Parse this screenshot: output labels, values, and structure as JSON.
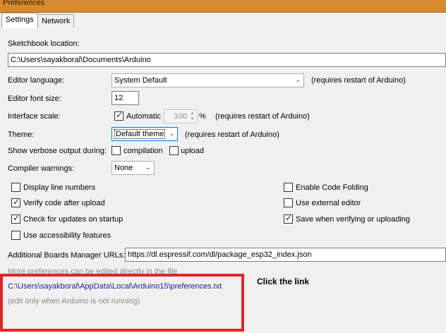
{
  "window": {
    "title": "Preferences"
  },
  "tabs": [
    {
      "label": "Settings",
      "active": true
    },
    {
      "label": "Network",
      "active": false
    }
  ],
  "settings": {
    "sketchbook_label": "Sketchbook location:",
    "sketchbook_value": "C:\\Users\\sayakboral\\Documents\\Arduino",
    "editor_language_label": "Editor language:",
    "editor_language_value": "System Default",
    "editor_language_note": "(requires restart of Arduino)",
    "font_size_label": "Editor font size:",
    "font_size_value": "12",
    "interface_scale_label": "Interface scale:",
    "automatic_label": "Automatic",
    "automatic_checked": true,
    "scale_value": "100",
    "scale_unit": "%",
    "scale_note": "(requires restart of Arduino)",
    "theme_label": "Theme:",
    "theme_value": "Default theme",
    "theme_note": "(requires restart of Arduino)",
    "verbose_label": "Show verbose output during:",
    "compilation_label": "compilation",
    "compilation_checked": false,
    "upload_label": "upload",
    "upload_checked": false,
    "compiler_warnings_label": "Compiler warnings:",
    "compiler_warnings_value": "None",
    "options_left": [
      {
        "label": "Display line numbers",
        "checked": false
      },
      {
        "label": "Verify code after upload",
        "checked": true
      },
      {
        "label": "Check for updates on startup",
        "checked": true
      },
      {
        "label": "Use accessibility features",
        "checked": false
      }
    ],
    "options_right": [
      {
        "label": "Enable Code Folding",
        "checked": false
      },
      {
        "label": "Use external editor",
        "checked": false
      },
      {
        "label": "Save when verifying or uploading",
        "checked": true
      }
    ],
    "boards_url_label": "Additional Boards Manager URLs:",
    "boards_url_value": "https://dl.espressif.com/dl/package_esp32_index.json",
    "more_prefs_note": "More preferences can be edited directly in the file",
    "prefs_path": "C:\\Users\\sayakboral\\AppData\\Local\\Arduino15\\preferences.txt",
    "edit_note": "(edit only when Arduino is not running)"
  },
  "annotation": {
    "text": "Click the link",
    "box_color": "#e0252a"
  },
  "icons": {
    "checkmark": "✓",
    "dropdown": "chevron-down-icon"
  },
  "colors": {
    "titlebar": "#d98a2c",
    "link": "#1a1a8c"
  }
}
